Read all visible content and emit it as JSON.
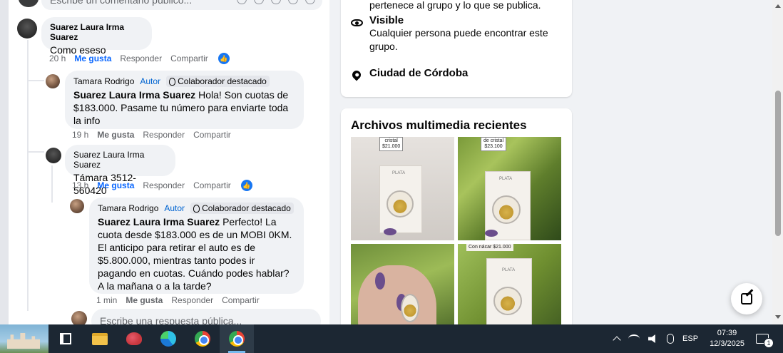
{
  "feed": {
    "top_input_placeholder": "Escribe un comentario público...",
    "comments": [
      {
        "author": "Suarez Laura Irma Suarez",
        "text": "Como eseso",
        "time": "20 h",
        "like_label": "Me gusta",
        "reply_label": "Responder",
        "share_label": "Compartir"
      },
      {
        "author": "Tamara Rodrigo",
        "autor_badge": "Autor",
        "colab_badge": "Colaborador destacado",
        "mention": "Suarez Laura Irma Suarez",
        "text": " Hola! Son cuotas de $183.000. Pasame tu número para enviarte toda la info",
        "time": "19 h",
        "like_label": "Me gusta",
        "reply_label": "Responder",
        "share_label": "Compartir"
      },
      {
        "author": "Suarez Laura Irma Suarez",
        "text": "Támara 3512-560420",
        "time": "13 h",
        "like_label": "Me gusta",
        "reply_label": "Responder",
        "share_label": "Compartir"
      },
      {
        "author": "Tamara Rodrigo",
        "autor_badge": "Autor",
        "colab_badge": "Colaborador destacado",
        "mention": "Suarez Laura Irma Suarez",
        "text": " Perfecto! La cuota desde $183.000 es de un MOBI 0KM. El anticipo para retirar el auto es de $5.800.000, mientras tanto podes ir pagando en cuotas. Cuándo podes hablar? A la mañana o a la tarde?",
        "time": "1 min",
        "like_label": "Me gusta",
        "reply_label": "Responder",
        "share_label": "Compartir"
      }
    ],
    "reply_placeholder": "Escribe una respuesta pública..."
  },
  "about": {
    "partial_line": "pertenece al grupo y lo que se publica.",
    "visible_title": "Visible",
    "visible_desc": "Cualquier persona puede encontrar este grupo.",
    "location": "Ciudad de Córdoba"
  },
  "media": {
    "title": "Archivos multimedia recientes",
    "thumbs": [
      {
        "top_label": "cristal",
        "price_label": "$21.000",
        "card_label": "PLATA"
      },
      {
        "top_label": "de cristal",
        "price_label": "$23.100",
        "card_label": "PLATA"
      },
      {
        "top_label": "",
        "price_label": "",
        "card_label": ""
      },
      {
        "top_label": "Con nácar $21.000",
        "price_label": "",
        "card_label": "PLATA"
      }
    ]
  },
  "taskbar": {
    "language": "ESP",
    "time": "07:39",
    "date": "12/3/2025",
    "notification_count": "1"
  },
  "colors": {
    "accent": "#0866ff",
    "bubble": "#f0f2f5",
    "taskbar": "#1c2733"
  }
}
